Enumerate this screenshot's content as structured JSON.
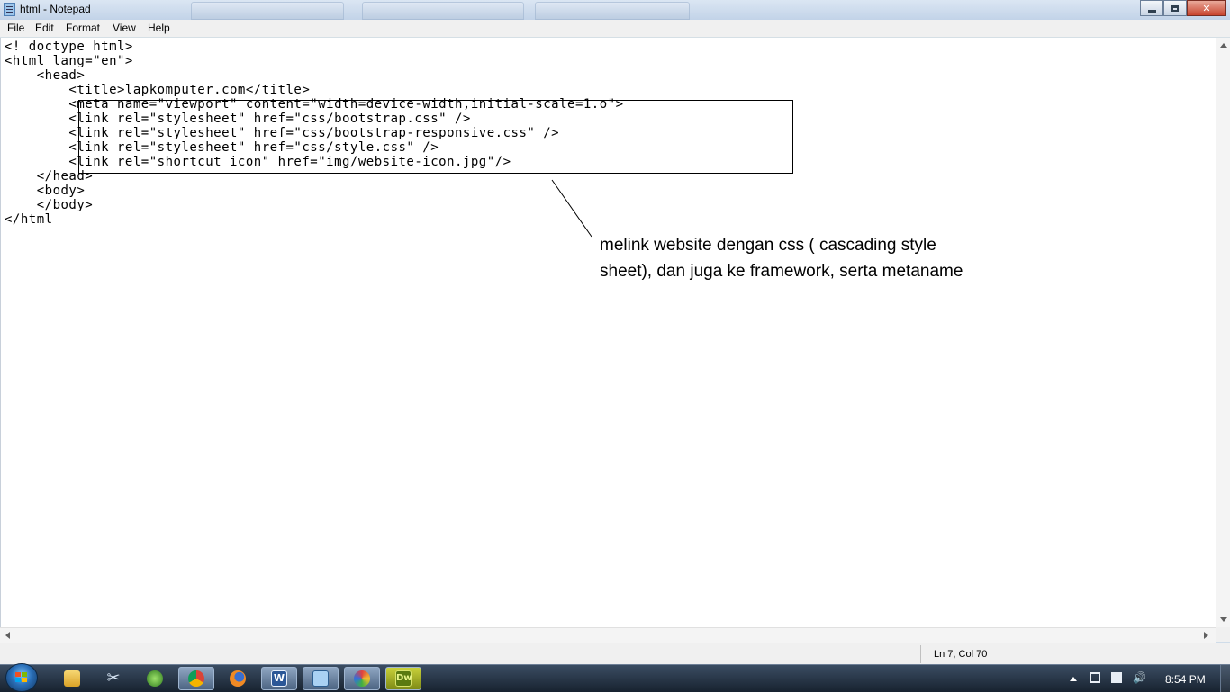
{
  "window": {
    "title": "html - Notepad",
    "app_icon": "notepad-icon",
    "controls": [
      "minimize-icon",
      "maximize-icon",
      "close-icon"
    ]
  },
  "menu": {
    "items": [
      "File",
      "Edit",
      "Format",
      "View",
      "Help"
    ]
  },
  "editor": {
    "lines": [
      "<! doctype html>",
      "<html lang=\"en\">",
      "    <head>",
      "        <title>lapkomputer.com</title>",
      "        <meta name=\"viewport\" content=\"width=device-width,initial-scale=1.o\">",
      "        <link rel=\"stylesheet\" href=\"css/bootstrap.css\" />",
      "        <link rel=\"stylesheet\" href=\"css/bootstrap-responsive.css\" />",
      "        <link rel=\"stylesheet\" href=\"css/style.css\" />",
      "        <link rel=\"shortcut icon\" href=\"img/website-icon.jpg\"/>",
      "    </head>",
      "    <body>",
      "    </body>",
      "</html"
    ],
    "annotation": "melink website dengan css ( cascading style sheet), dan juga ke framework, serta metaname"
  },
  "status": {
    "position": "Ln 7, Col 70"
  },
  "taskbar": {
    "start_icon": "windows-start-icon",
    "apps": [
      {
        "icon": "windows-explorer-icon",
        "active": false
      },
      {
        "icon": "snipping-tool-icon",
        "active": false
      },
      {
        "icon": "network-globe-icon",
        "active": false
      },
      {
        "icon": "chrome-icon",
        "active": true
      },
      {
        "icon": "firefox-icon",
        "active": false
      },
      {
        "icon": "word-icon",
        "active": true
      },
      {
        "icon": "notepad-icon",
        "active": true
      },
      {
        "icon": "paint-icon",
        "active": true
      },
      {
        "icon": "dreamweaver-icon",
        "active": true
      }
    ],
    "tray_icons": [
      "show-hidden-icons-arrow",
      "network-icon",
      "action-center-icon",
      "volume-icon"
    ],
    "clock": "8:54 PM",
    "dreamweaver_label": "Dw"
  },
  "colors": {
    "taskbar": "#1f2d3d",
    "close_button": "#c8452f",
    "titlebar": "#c2d3e8"
  }
}
